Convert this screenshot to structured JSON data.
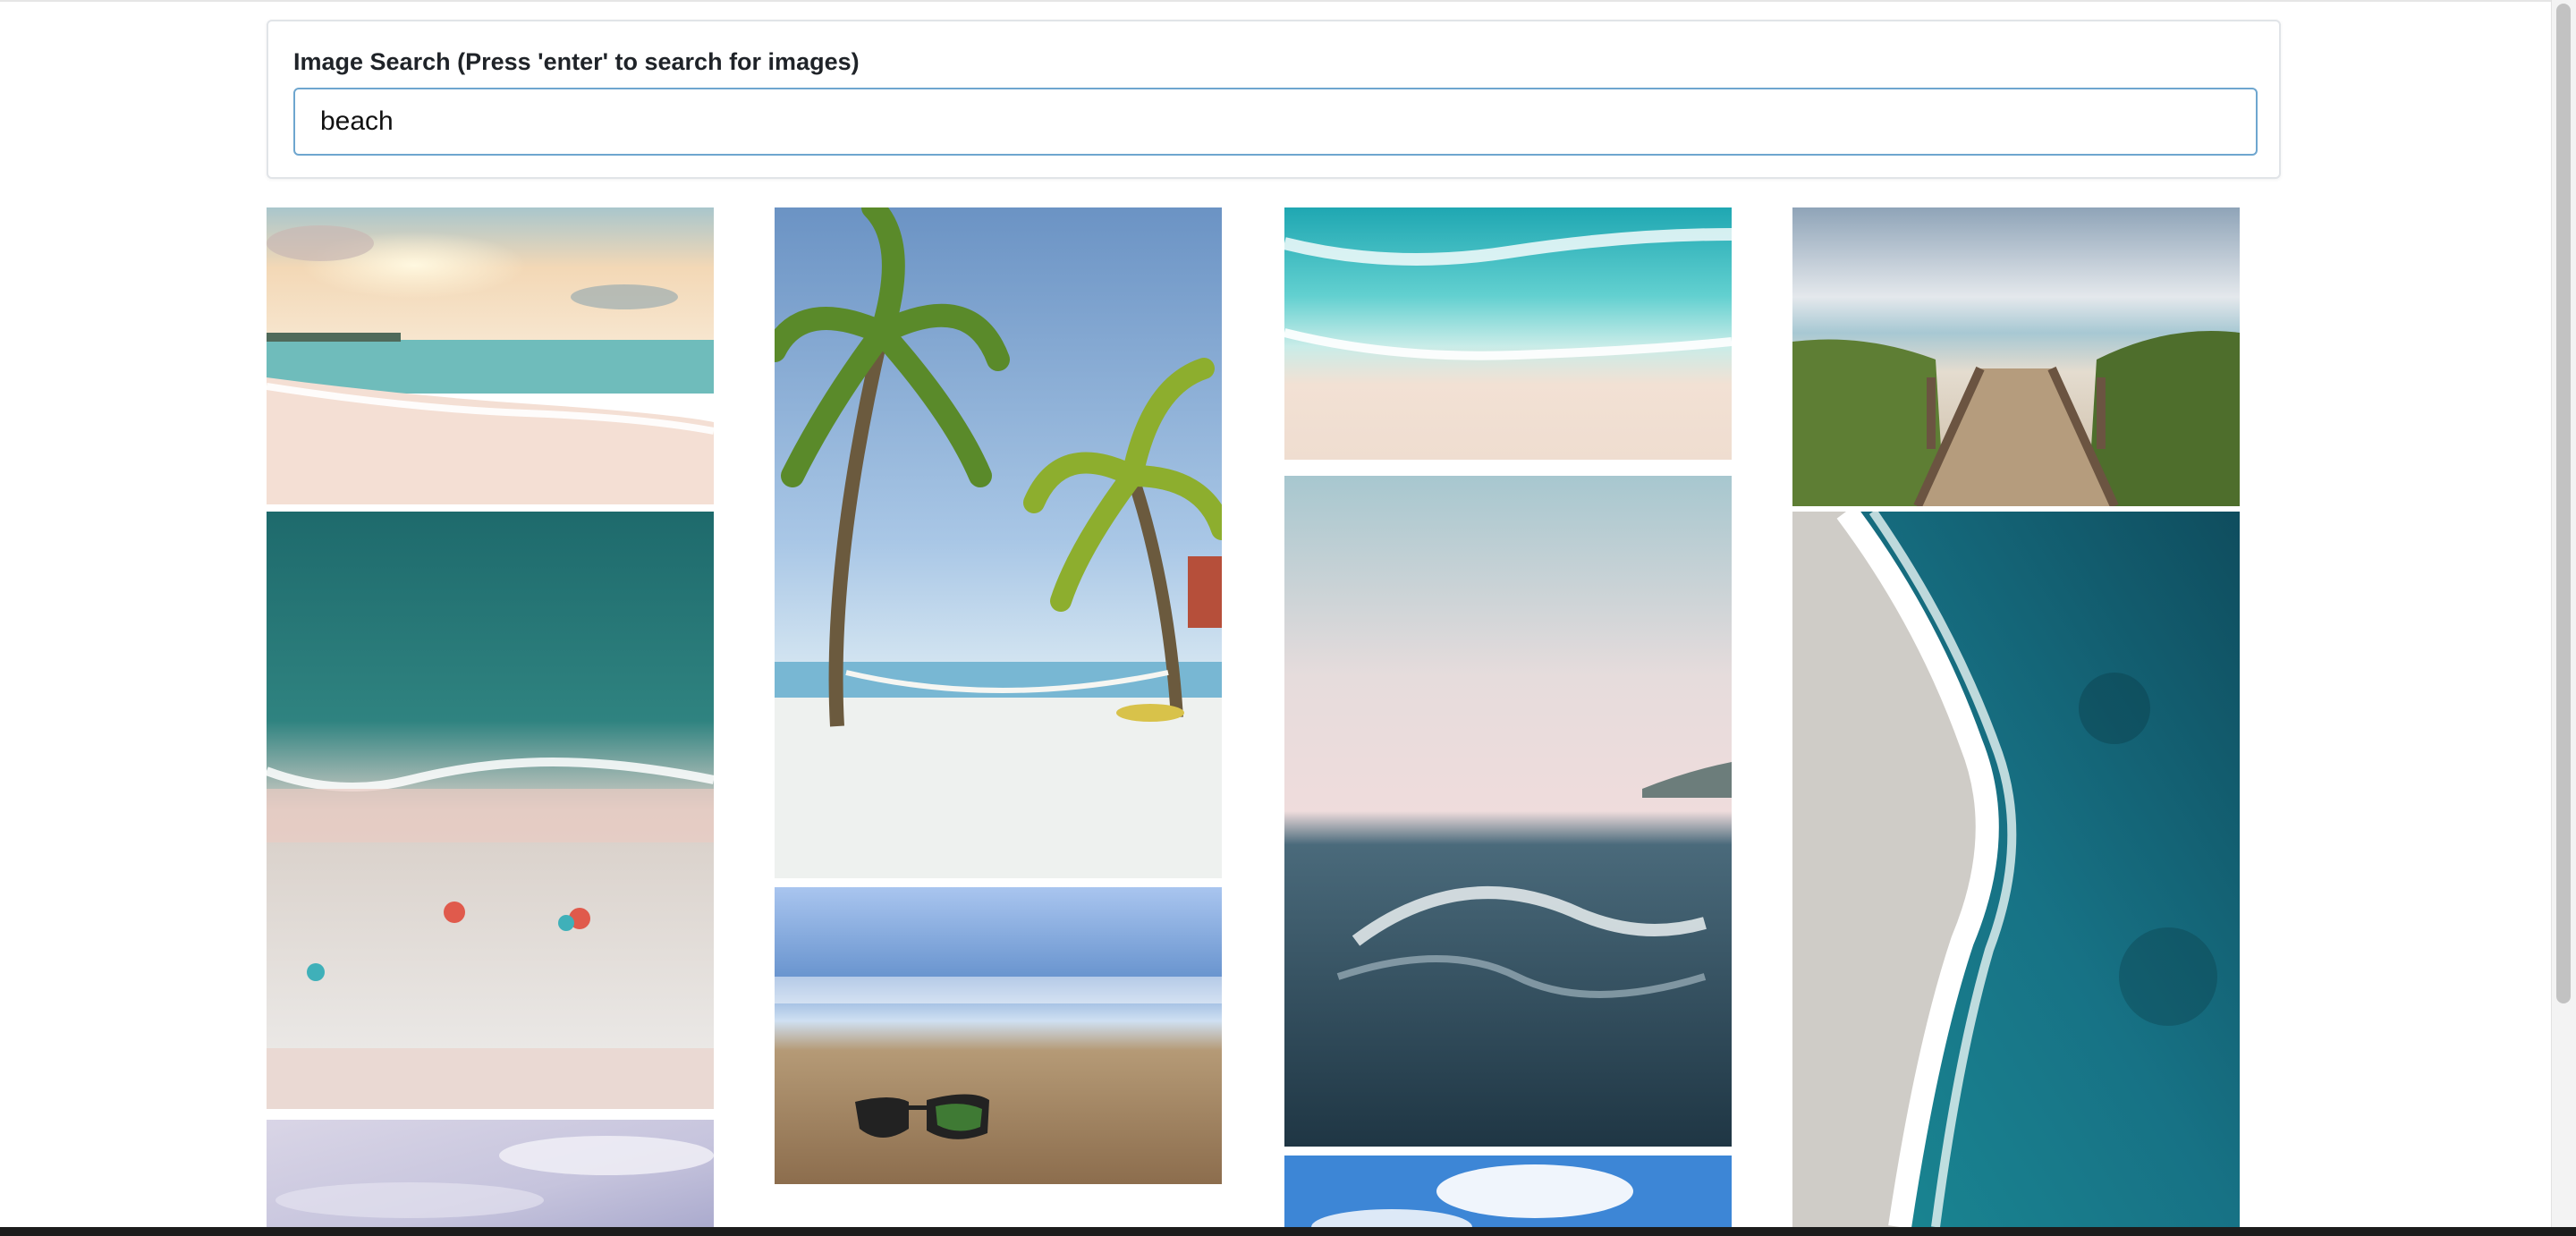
{
  "search": {
    "label": "Image Search (Press 'enter' to search for images)",
    "value": "beach",
    "placeholder": ""
  },
  "results": {
    "columns": 4,
    "images": [
      {
        "subject": "beach-sunset-waves"
      },
      {
        "subject": "aerial-beach-umbrellas"
      },
      {
        "subject": "cloudy-sky"
      },
      {
        "subject": "palm-trees-hammock"
      },
      {
        "subject": "sunglasses-on-sand"
      },
      {
        "subject": "aerial-turquoise-shoreline"
      },
      {
        "subject": "ocean-wave-closeup"
      },
      {
        "subject": "blue-sky-clouds"
      },
      {
        "subject": "boardwalk-to-beach"
      },
      {
        "subject": "aerial-deep-blue-coast"
      }
    ]
  }
}
